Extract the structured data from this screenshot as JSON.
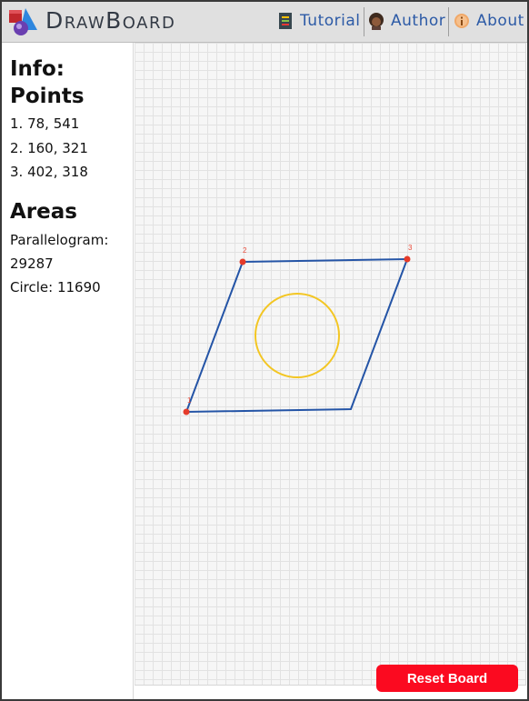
{
  "app": {
    "title": "DrawBoard",
    "logo_icon": "shapes-logo-icon"
  },
  "nav": {
    "tutorial_label": "Tutorial",
    "author_label": "Author",
    "about_label": "About"
  },
  "sidebar": {
    "info_heading": "Info:",
    "points_heading": "Points",
    "points": [
      "1. 78, 541",
      "2. 160, 321",
      "3. 402, 318"
    ],
    "areas_heading": "Areas",
    "parallelogram_label": "Parallelogram:",
    "parallelogram_value": "29287",
    "circle_text": "Circle: 11690"
  },
  "board": {
    "point_labels": [
      "1",
      "2",
      "3"
    ],
    "colors": {
      "shape": "#2454a6",
      "circle": "#f3c623",
      "point": "#e53b2a",
      "label": "#e84b3a"
    }
  },
  "reset_label": "Reset Board"
}
